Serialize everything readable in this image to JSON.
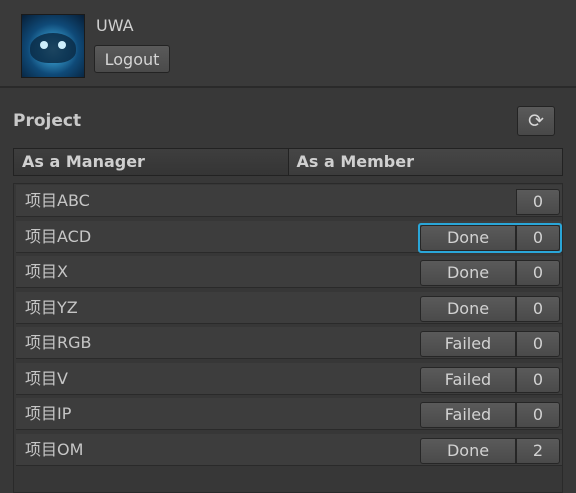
{
  "user": {
    "name": "UWA",
    "logout_label": "Logout",
    "avatar_icon": "shark-avatar-icon"
  },
  "project": {
    "title": "Project",
    "refresh_icon": "refresh-icon",
    "tabs": [
      {
        "label": "As a Manager",
        "active": true
      },
      {
        "label": "As a Member",
        "active": false
      }
    ],
    "rows": [
      {
        "name": "项目ABC",
        "status": "",
        "count": "0",
        "focused": false
      },
      {
        "name": "项目ACD",
        "status": "Done",
        "count": "0",
        "focused": true
      },
      {
        "name": "项目X",
        "status": "Done",
        "count": "0",
        "focused": false
      },
      {
        "name": "项目YZ",
        "status": "Done",
        "count": "0",
        "focused": false
      },
      {
        "name": "项目RGB",
        "status": "Failed",
        "count": "0",
        "focused": false
      },
      {
        "name": "项目V",
        "status": "Failed",
        "count": "0",
        "focused": false
      },
      {
        "name": "项目IP",
        "status": "Failed",
        "count": "0",
        "focused": false
      },
      {
        "name": "项目OM",
        "status": "Done",
        "count": "2",
        "focused": false
      }
    ]
  },
  "colors": {
    "background": "#383838",
    "focus_ring": "#2aa6d8"
  }
}
